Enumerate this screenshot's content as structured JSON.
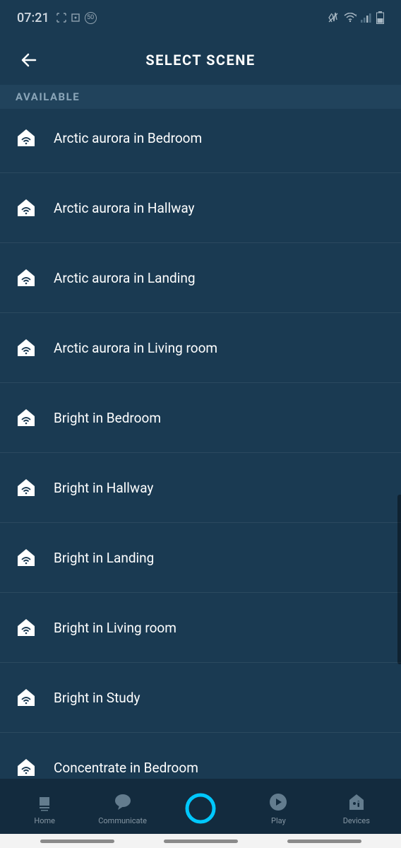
{
  "status": {
    "time": "07:21",
    "badge": "50"
  },
  "header": {
    "title": "SELECT SCENE"
  },
  "section": {
    "label": "AVAILABLE"
  },
  "scenes": [
    {
      "label": "Arctic aurora in Bedroom"
    },
    {
      "label": "Arctic aurora in Hallway"
    },
    {
      "label": "Arctic aurora in Landing"
    },
    {
      "label": "Arctic aurora in Living room"
    },
    {
      "label": "Bright in Bedroom"
    },
    {
      "label": "Bright in Hallway"
    },
    {
      "label": "Bright in Landing"
    },
    {
      "label": "Bright in Living room"
    },
    {
      "label": "Bright in Study"
    },
    {
      "label": "Concentrate in Bedroom"
    }
  ],
  "nav": {
    "home": "Home",
    "communicate": "Communicate",
    "play": "Play",
    "devices": "Devices"
  }
}
